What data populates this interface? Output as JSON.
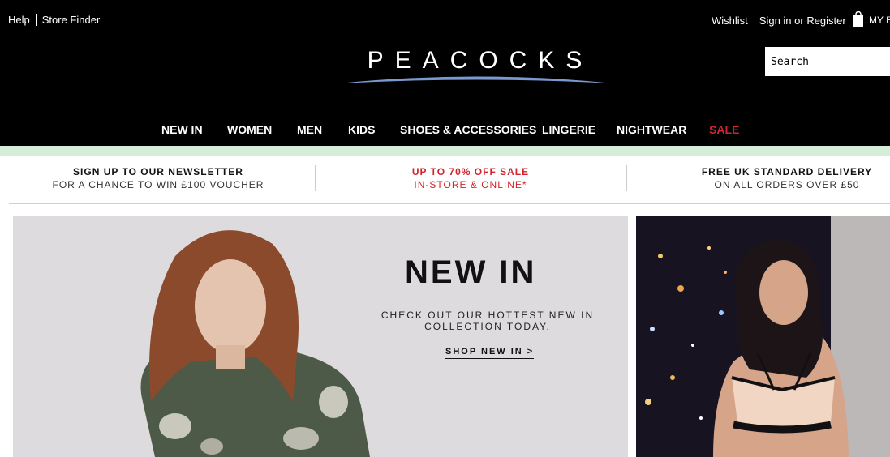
{
  "utility": {
    "help": "Help",
    "store_finder": "Store Finder",
    "wishlist": "Wishlist",
    "sign_in": "Sign in or Register",
    "my_bag": "MY B"
  },
  "logo": {
    "text": "PEACOCKS"
  },
  "search": {
    "placeholder": "Search"
  },
  "nav": {
    "items": [
      {
        "label": "NEW IN"
      },
      {
        "label": "WOMEN"
      },
      {
        "label": "MEN"
      },
      {
        "label": "KIDS"
      },
      {
        "label": "SHOES & ACCESSORIES"
      },
      {
        "label": "LINGERIE"
      },
      {
        "label": "NIGHTWEAR"
      },
      {
        "label": "SALE",
        "color": "#d2232a"
      }
    ]
  },
  "promo": [
    {
      "line1": "SIGN UP TO OUR NEWSLETTER",
      "line2": "FOR A CHANCE TO WIN £100 VOUCHER"
    },
    {
      "line1": "UP TO 70% OFF SALE",
      "line2": "IN-STORE & ONLINE*"
    },
    {
      "line1": "FREE UK STANDARD DELIVERY",
      "line2": "ON ALL ORDERS OVER £50"
    }
  ],
  "hero": {
    "title": "NEW IN",
    "subtitle_line1": "CHECK OUT OUR HOTTEST NEW IN",
    "subtitle_line2": "COLLECTION TODAY.",
    "cta": "SHOP NEW IN >"
  },
  "colors": {
    "header_bg": "#000000",
    "accent_stripe": "#d4eed8",
    "sale_red": "#d2232a",
    "logo_swoosh": "#7a9bd1"
  }
}
